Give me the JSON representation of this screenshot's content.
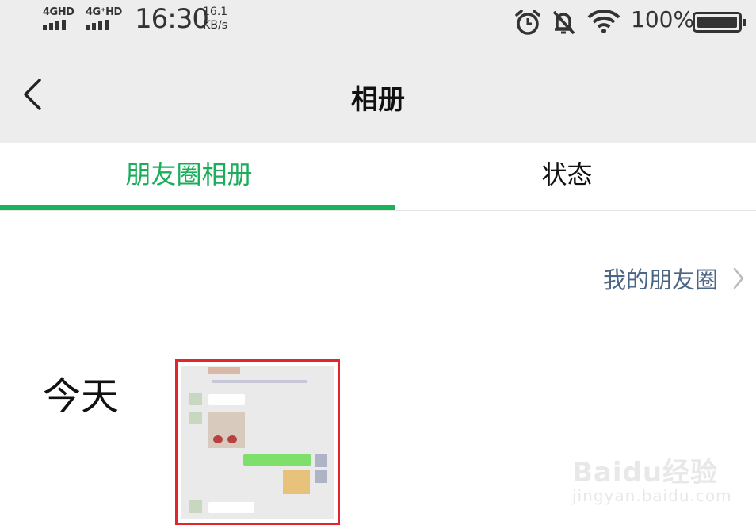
{
  "status_bar": {
    "signal1_label": "4GHD",
    "signal2_label": "4G⁺HD",
    "time": "16:30",
    "speed_value": "16.1",
    "speed_unit": "KB/s",
    "icons": [
      "alarm-icon",
      "mute-bell-icon",
      "wifi-icon",
      "battery-icon"
    ],
    "battery_percent": "100%"
  },
  "header": {
    "back_icon": "chevron-left-icon",
    "title": "相册"
  },
  "tabs": [
    {
      "label": "朋友圈相册",
      "active": true
    },
    {
      "label": "状态",
      "active": false
    }
  ],
  "my_moments": {
    "label": "我的朋友圈",
    "icon": "chevron-right-icon"
  },
  "album": {
    "date_label": "今天"
  },
  "colors": {
    "accent_green": "#1aad5a",
    "link_blue": "#4b6585",
    "highlight_red": "#e3262e",
    "bar_gray": "#ededed"
  },
  "watermark": {
    "brand": "Baidu经验",
    "url": "jingyan.baidu.com"
  }
}
